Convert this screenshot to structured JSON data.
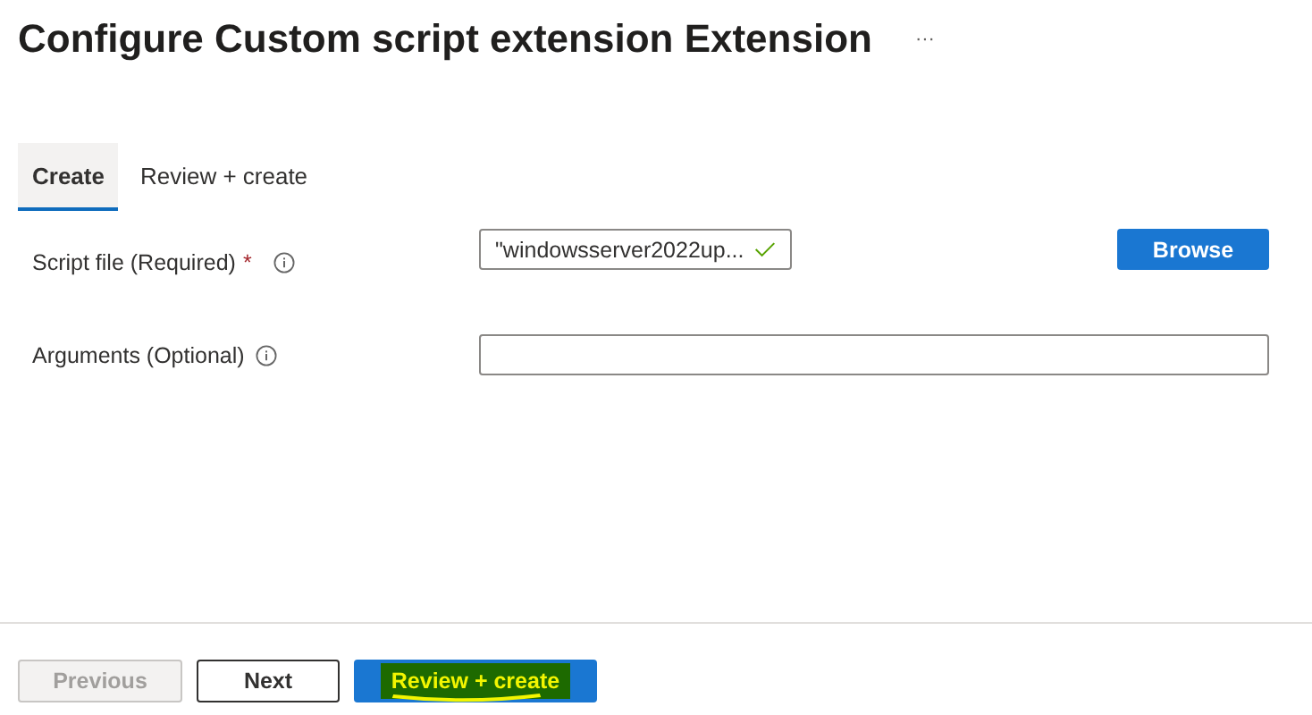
{
  "title": "Configure Custom script extension Extension",
  "more": "···",
  "tabs": [
    {
      "label": "Create",
      "selected": true
    },
    {
      "label": "Review + create",
      "selected": false
    }
  ],
  "fields": [
    {
      "label": "Script file (Required)",
      "required_mark": "*",
      "value": "\"windowsserver2022up...",
      "valid": true,
      "kind": "file",
      "button": "Browse"
    },
    {
      "label": "Arguments (Optional)",
      "kind": "text"
    }
  ],
  "footer": [
    {
      "label": "Previous",
      "kind": "secondary",
      "disabled": true,
      "highlighted": false
    },
    {
      "label": "Next",
      "kind": "secondary",
      "disabled": false,
      "highlighted": false
    },
    {
      "label": "Review + create",
      "kind": "primary",
      "disabled": false,
      "highlighted": true
    }
  ]
}
